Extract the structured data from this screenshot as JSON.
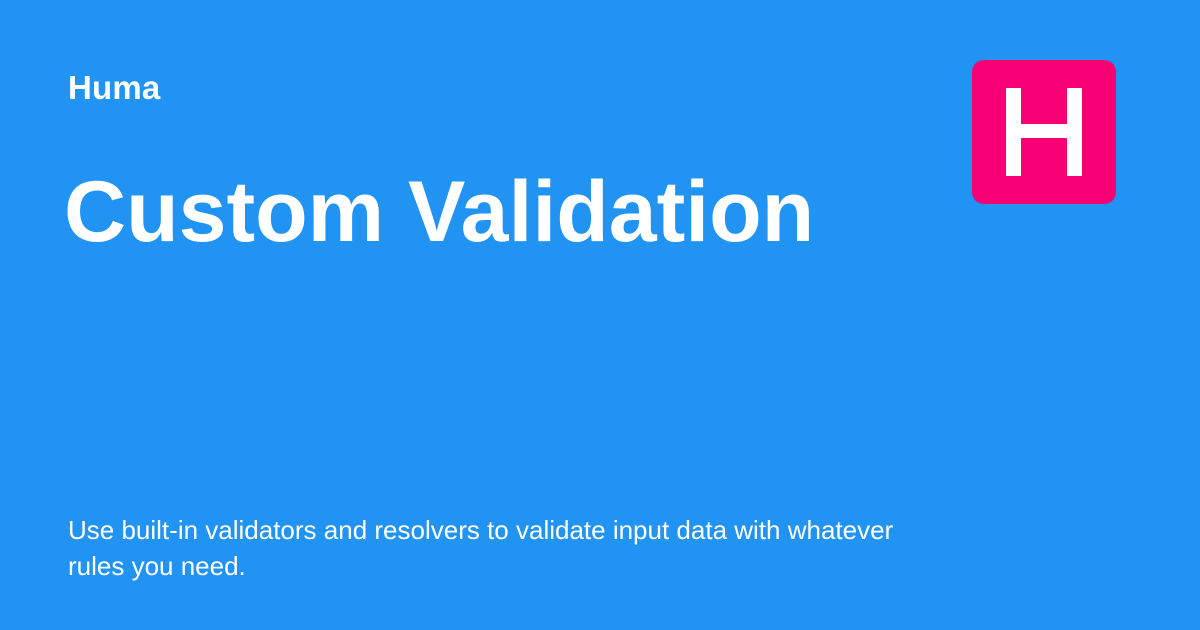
{
  "card": {
    "brand": "Huma",
    "title": "Custom Validation",
    "description": "Use built-in validators and resolvers to validate input data with whatever rules you need.",
    "logo": {
      "icon": "huma-logo-icon",
      "letter": "H",
      "color": "#f70074"
    },
    "background_color": "#2193f3"
  }
}
